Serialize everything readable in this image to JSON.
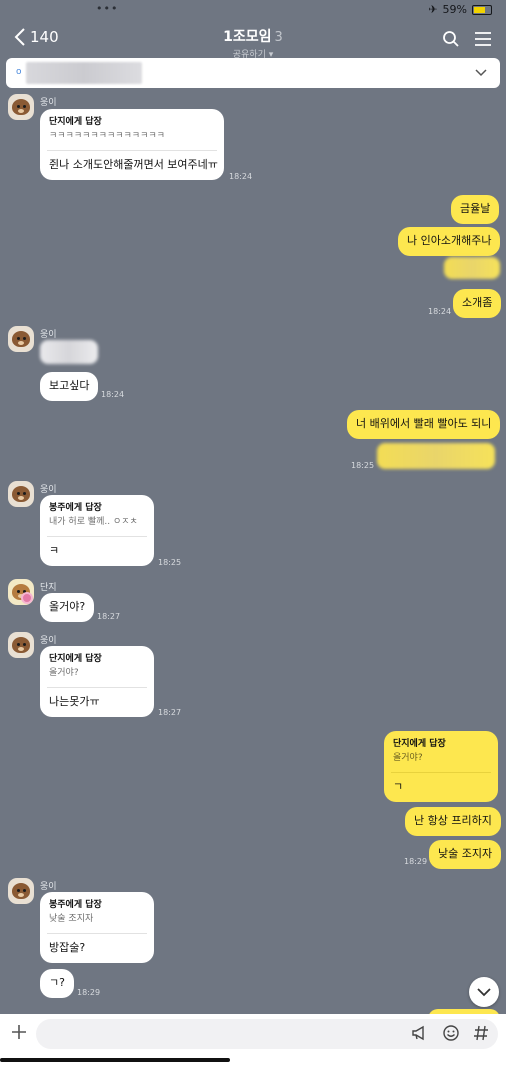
{
  "status": {
    "dots": "•••",
    "battery": "59%"
  },
  "header": {
    "back_count": "140",
    "title": "1조모임",
    "member_count": "3",
    "subtitle": "공유하기 ▾"
  },
  "notice": {
    "prefix": "o"
  },
  "messages": [
    {
      "sender": "웅이",
      "reply_title": "단지에게 답장",
      "reply_quote": "ㅋㅋㅋㅋㅋㅋㅋㅋㅋㅋㅋㅋㅋㅋ",
      "text": "쥔나 소개도안해줄꺼면서 보여주네ㅠ",
      "time": "18:24"
    },
    {
      "text": "금율날"
    },
    {
      "text": "나 인아소개해주나"
    },
    {
      "text": "소개좀",
      "time": "18:24"
    },
    {
      "sender": "웅이",
      "text": "보고싶다",
      "time": "18:24"
    },
    {
      "text": "너 배위에서 빨래 빨아도 되니",
      "time": "18:25"
    },
    {
      "sender": "웅이",
      "reply_title": "봉주에게 답장",
      "reply_quote": "내가 허로 빨께.. ㅇㅈㅊ",
      "text": "ㅋ",
      "time": "18:25"
    },
    {
      "sender": "단지",
      "text": "올거야?",
      "time": "18:27"
    },
    {
      "sender": "웅이",
      "reply_title": "단지에게 답장",
      "reply_quote": "올거야?",
      "text": "나는못가ㅠ",
      "time": "18:27"
    },
    {
      "reply_title": "단지에게 답장",
      "reply_quote": "올거야?",
      "text": "ㄱ"
    },
    {
      "text": "난 항상 프리하지"
    },
    {
      "text": "낮술 조지자",
      "time": "18:29"
    },
    {
      "sender": "웅이",
      "reply_title": "봉주에게 답장",
      "reply_quote": "낮술 조지자",
      "text": "방잡술?"
    },
    {
      "text": "ㄱ?",
      "time": "18:29"
    }
  ],
  "input": {
    "placeholder": ""
  },
  "colors": {
    "background": "#6f7682",
    "my_bubble": "#fde74f",
    "their_bubble": "#ffffff"
  }
}
